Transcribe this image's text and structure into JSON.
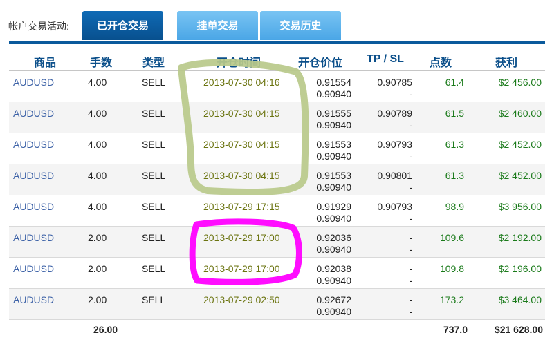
{
  "account_label": "帐户交易活动:",
  "tabs": [
    {
      "label": "已开仓交易",
      "active": true
    },
    {
      "label": "挂单交易",
      "active": false
    },
    {
      "label": "交易历史",
      "active": false
    }
  ],
  "columns": {
    "symbol": "商品",
    "lots": "手数",
    "type": "类型",
    "open_time": "开仓时间",
    "open_price": "开仓价位",
    "tp_sl": "TP / SL",
    "points": "点数",
    "profit": "获利"
  },
  "rows": [
    {
      "symbol": "AUDUSD",
      "lots": "4.00",
      "type": "SELL",
      "open_time": "2013-07-30 04:16",
      "open_price": "0.91554",
      "price2": "0.90940",
      "tp": "0.90785",
      "sl": "-",
      "points": "61.4",
      "profit": "$2 456.00"
    },
    {
      "symbol": "AUDUSD",
      "lots": "4.00",
      "type": "SELL",
      "open_time": "2013-07-30 04:15",
      "open_price": "0.91555",
      "price2": "0.90940",
      "tp": "0.90789",
      "sl": "-",
      "points": "61.5",
      "profit": "$2 460.00"
    },
    {
      "symbol": "AUDUSD",
      "lots": "4.00",
      "type": "SELL",
      "open_time": "2013-07-30 04:15",
      "open_price": "0.91553",
      "price2": "0.90940",
      "tp": "0.90793",
      "sl": "-",
      "points": "61.3",
      "profit": "$2 452.00"
    },
    {
      "symbol": "AUDUSD",
      "lots": "4.00",
      "type": "SELL",
      "open_time": "2013-07-30 04:15",
      "open_price": "0.91553",
      "price2": "0.90940",
      "tp": "0.90801",
      "sl": "-",
      "points": "61.3",
      "profit": "$2 452.00"
    },
    {
      "symbol": "AUDUSD",
      "lots": "4.00",
      "type": "SELL",
      "open_time": "2013-07-29 17:15",
      "open_price": "0.91929",
      "price2": "0.90940",
      "tp": "0.90793",
      "sl": "-",
      "points": "98.9",
      "profit": "$3 956.00"
    },
    {
      "symbol": "AUDUSD",
      "lots": "2.00",
      "type": "SELL",
      "open_time": "2013-07-29 17:00",
      "open_price": "0.92036",
      "price2": "0.90940",
      "tp": "-",
      "sl": "-",
      "points": "109.6",
      "profit": "$2 192.00"
    },
    {
      "symbol": "AUDUSD",
      "lots": "2.00",
      "type": "SELL",
      "open_time": "2013-07-29 17:00",
      "open_price": "0.92038",
      "price2": "0.90940",
      "tp": "-",
      "sl": "-",
      "points": "109.8",
      "profit": "$2 196.00"
    },
    {
      "symbol": "AUDUSD",
      "lots": "2.00",
      "type": "SELL",
      "open_time": "2013-07-29 02:50",
      "open_price": "0.92672",
      "price2": "0.90940",
      "tp": "-",
      "sl": "-",
      "points": "173.2",
      "profit": "$3 464.00"
    }
  ],
  "totals": {
    "lots": "26.00",
    "points": "737.0",
    "profit": "$21 628.00"
  },
  "colors": {
    "active_tab": "#0b5a9c",
    "inactive_tab": "#5cb3ec",
    "header_text": "#0b4f8a",
    "profit_text": "#1a7a1a",
    "time_text": "#6b7410",
    "symbol_text": "#3d62a7",
    "annotation_green": "#b8c98a",
    "annotation_magenta": "#ff00ff"
  }
}
